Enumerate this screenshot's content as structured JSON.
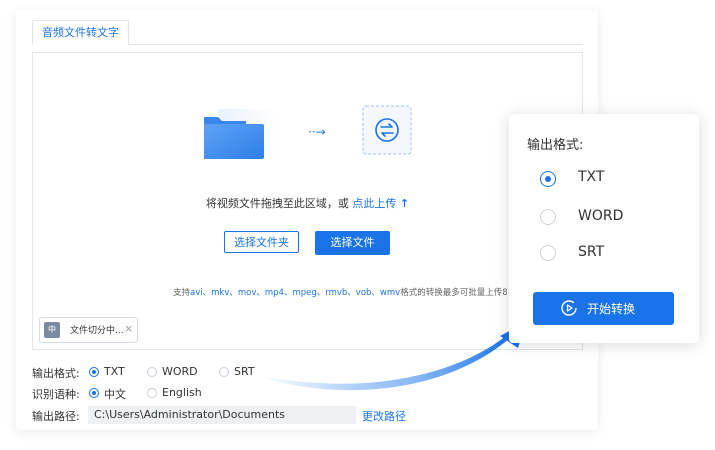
{
  "tab": {
    "label": "音频文件转文字"
  },
  "dropzone": {
    "hint_prefix": "将视频文件拖拽至此区域，或",
    "upload_link": "点此上传",
    "upload_arrow": "↑",
    "btn_select_folder": "选择文件夹",
    "btn_select_file": "选择文件",
    "formats_prefix": "支持",
    "formats_list": "avi、mkv、mov、mp4、mpeg、rmvb、vob、wmv",
    "formats_suffix": "格式的转换最多可批量上传8"
  },
  "file_chip": {
    "icon_glyph": "中",
    "name": "文件切分中...",
    "close": "×"
  },
  "output_format": {
    "label": "输出格式:",
    "options": [
      "TXT",
      "WORD",
      "SRT"
    ],
    "selected": "TXT"
  },
  "language": {
    "label": "识别语种:",
    "options": [
      "中文",
      "English"
    ],
    "selected": "中文"
  },
  "output_path": {
    "label": "输出路径:",
    "value": "C:\\Users\\Administrator\\Documents",
    "change_link": "更改路径"
  },
  "popup": {
    "title": "输出格式:",
    "options": [
      "TXT",
      "WORD",
      "SRT"
    ],
    "selected": "TXT",
    "start_button": "开始转换"
  },
  "colors": {
    "accent": "#1a73e8",
    "border": "#e2e6ee",
    "muted_fill": "#eef0f3"
  },
  "icons": [
    "folder-icon",
    "arrow-right-icon",
    "convert-icon",
    "upload-arrow-icon",
    "file-icon",
    "close-icon",
    "play-icon"
  ]
}
